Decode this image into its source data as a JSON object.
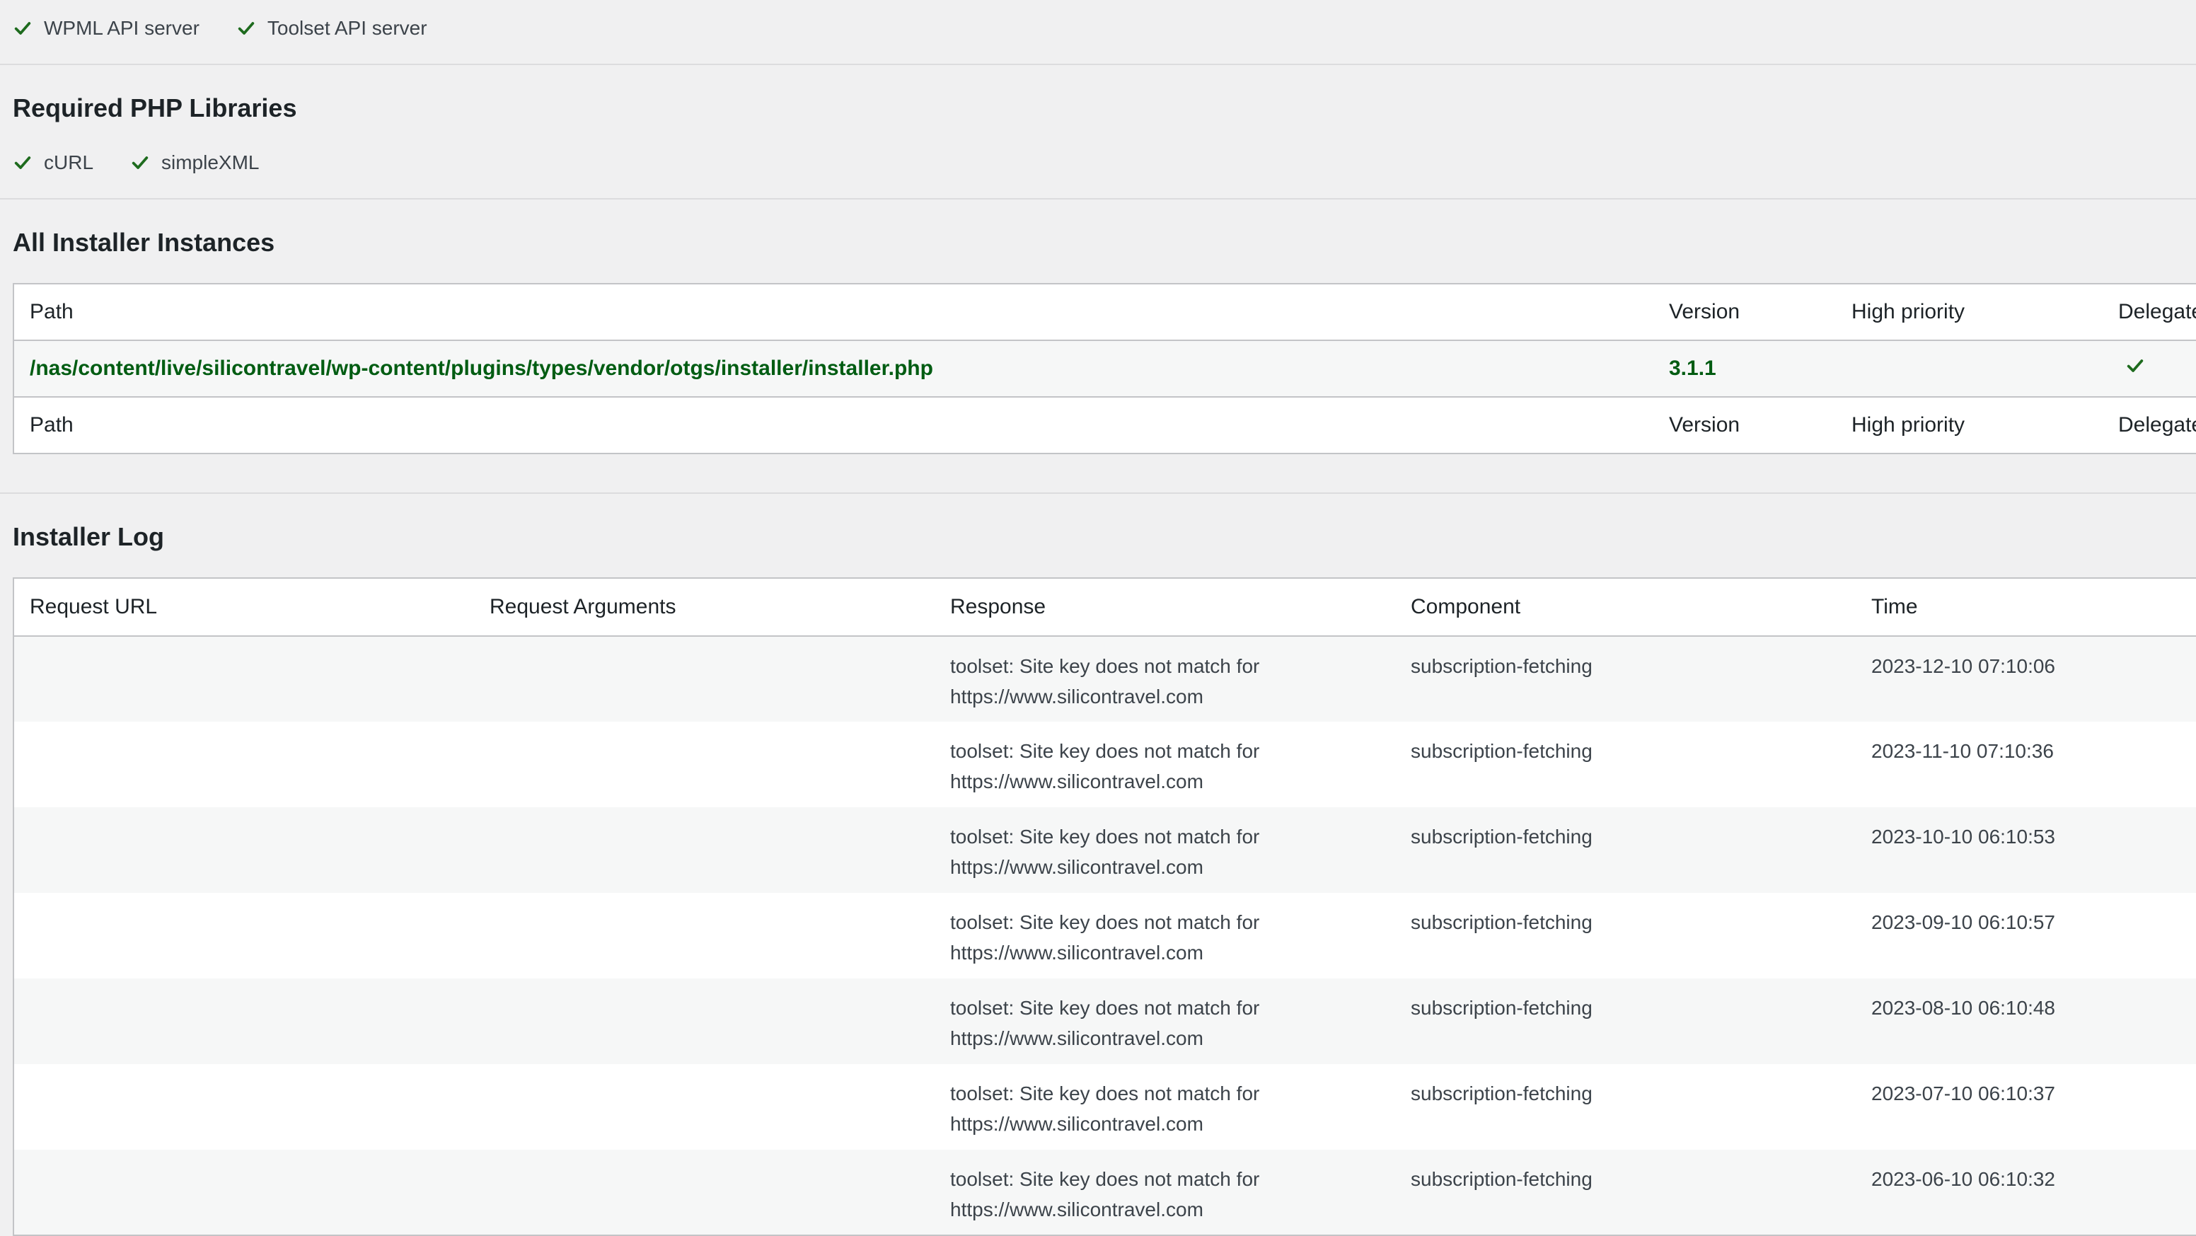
{
  "servers": {
    "items": [
      {
        "label": "WPML API server",
        "icon": "checkmark-icon"
      },
      {
        "label": "Toolset API server",
        "icon": "checkmark-icon"
      }
    ]
  },
  "libraries": {
    "title": "Required PHP Libraries",
    "items": [
      {
        "label": "cURL",
        "icon": "checkmark-icon"
      },
      {
        "label": "simpleXML",
        "icon": "checkmark-icon"
      }
    ]
  },
  "instances": {
    "title": "All Installer Instances",
    "columns": [
      "Path",
      "Version",
      "High priority",
      "Delegated"
    ],
    "rows": [
      {
        "path": "/nas/content/live/silicontravel/wp-content/plugins/types/vendor/otgs/installer/installer.php",
        "version": "3.1.1",
        "high_priority": "",
        "delegated": "checkmark-icon"
      }
    ]
  },
  "log": {
    "title": "Installer Log",
    "columns": [
      "Request URL",
      "Request Arguments",
      "Response",
      "Component",
      "Time"
    ],
    "rows": [
      {
        "url": "",
        "args": "",
        "response_1": "toolset: Site key does not match for",
        "response_2": "https://www.silicontravel.com",
        "component": "subscription-fetching",
        "time": "2023-12-10 07:10:06"
      },
      {
        "url": "",
        "args": "",
        "response_1": "toolset: Site key does not match for",
        "response_2": "https://www.silicontravel.com",
        "component": "subscription-fetching",
        "time": "2023-11-10 07:10:36"
      },
      {
        "url": "",
        "args": "",
        "response_1": "toolset: Site key does not match for",
        "response_2": "https://www.silicontravel.com",
        "component": "subscription-fetching",
        "time": "2023-10-10 06:10:53"
      },
      {
        "url": "",
        "args": "",
        "response_1": "toolset: Site key does not match for",
        "response_2": "https://www.silicontravel.com",
        "component": "subscription-fetching",
        "time": "2023-09-10 06:10:57"
      },
      {
        "url": "",
        "args": "",
        "response_1": "toolset: Site key does not match for",
        "response_2": "https://www.silicontravel.com",
        "component": "subscription-fetching",
        "time": "2023-08-10 06:10:48"
      },
      {
        "url": "",
        "args": "",
        "response_1": "toolset: Site key does not match for",
        "response_2": "https://www.silicontravel.com",
        "component": "subscription-fetching",
        "time": "2023-07-10 06:10:37"
      },
      {
        "url": "",
        "args": "",
        "response_1": "toolset: Site key does not match for",
        "response_2": "https://www.silicontravel.com",
        "component": "subscription-fetching",
        "time": "2023-06-10 06:10:32"
      }
    ]
  },
  "colors": {
    "check": "#1e6b1e",
    "active_path": "#005c12",
    "background": "#f0f0f1"
  }
}
